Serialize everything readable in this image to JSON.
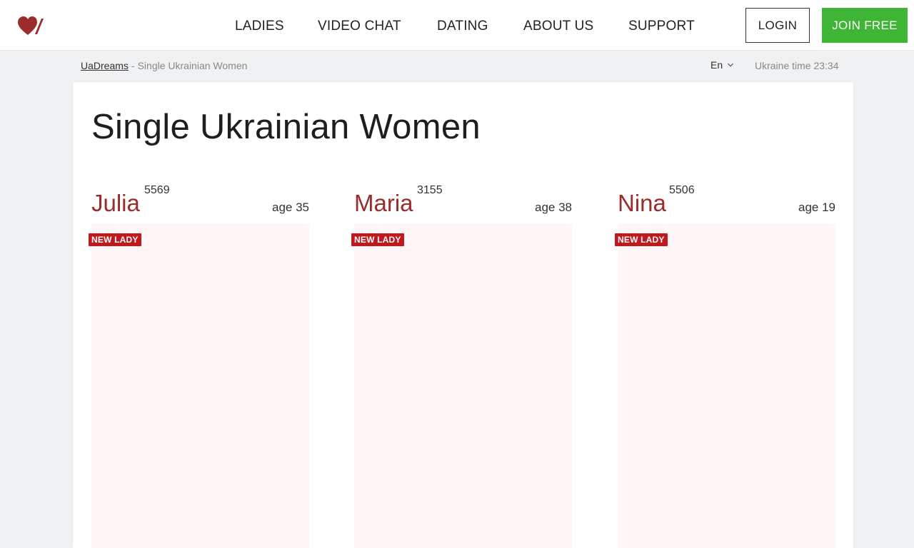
{
  "header": {
    "logo": "heart-slash-logo",
    "nav": [
      "LADIES",
      "VIDEO CHAT",
      "DATING",
      "ABOUT US",
      "SUPPORT"
    ],
    "login_label": "LOGIN",
    "join_label": "JOIN FREE",
    "colors": {
      "logo": "#9c2b2b",
      "join_bg": "#3fb536"
    }
  },
  "subbar": {
    "breadcrumb_home": "UaDreams",
    "breadcrumb_sep": "-",
    "breadcrumb_current": "Single Ukrainian Women",
    "language": "En",
    "ukraine_time": "Ukraine time 23:34"
  },
  "page": {
    "title": "Single Ukrainian Women"
  },
  "ladies": [
    {
      "name": "Julia",
      "id": "5569",
      "age": "age 35",
      "badge": "NEW LADY"
    },
    {
      "name": "Maria",
      "id": "3155",
      "age": "age 38",
      "badge": "NEW LADY"
    },
    {
      "name": "Nina",
      "id": "5506",
      "age": "age 19",
      "badge": "NEW LADY"
    }
  ]
}
